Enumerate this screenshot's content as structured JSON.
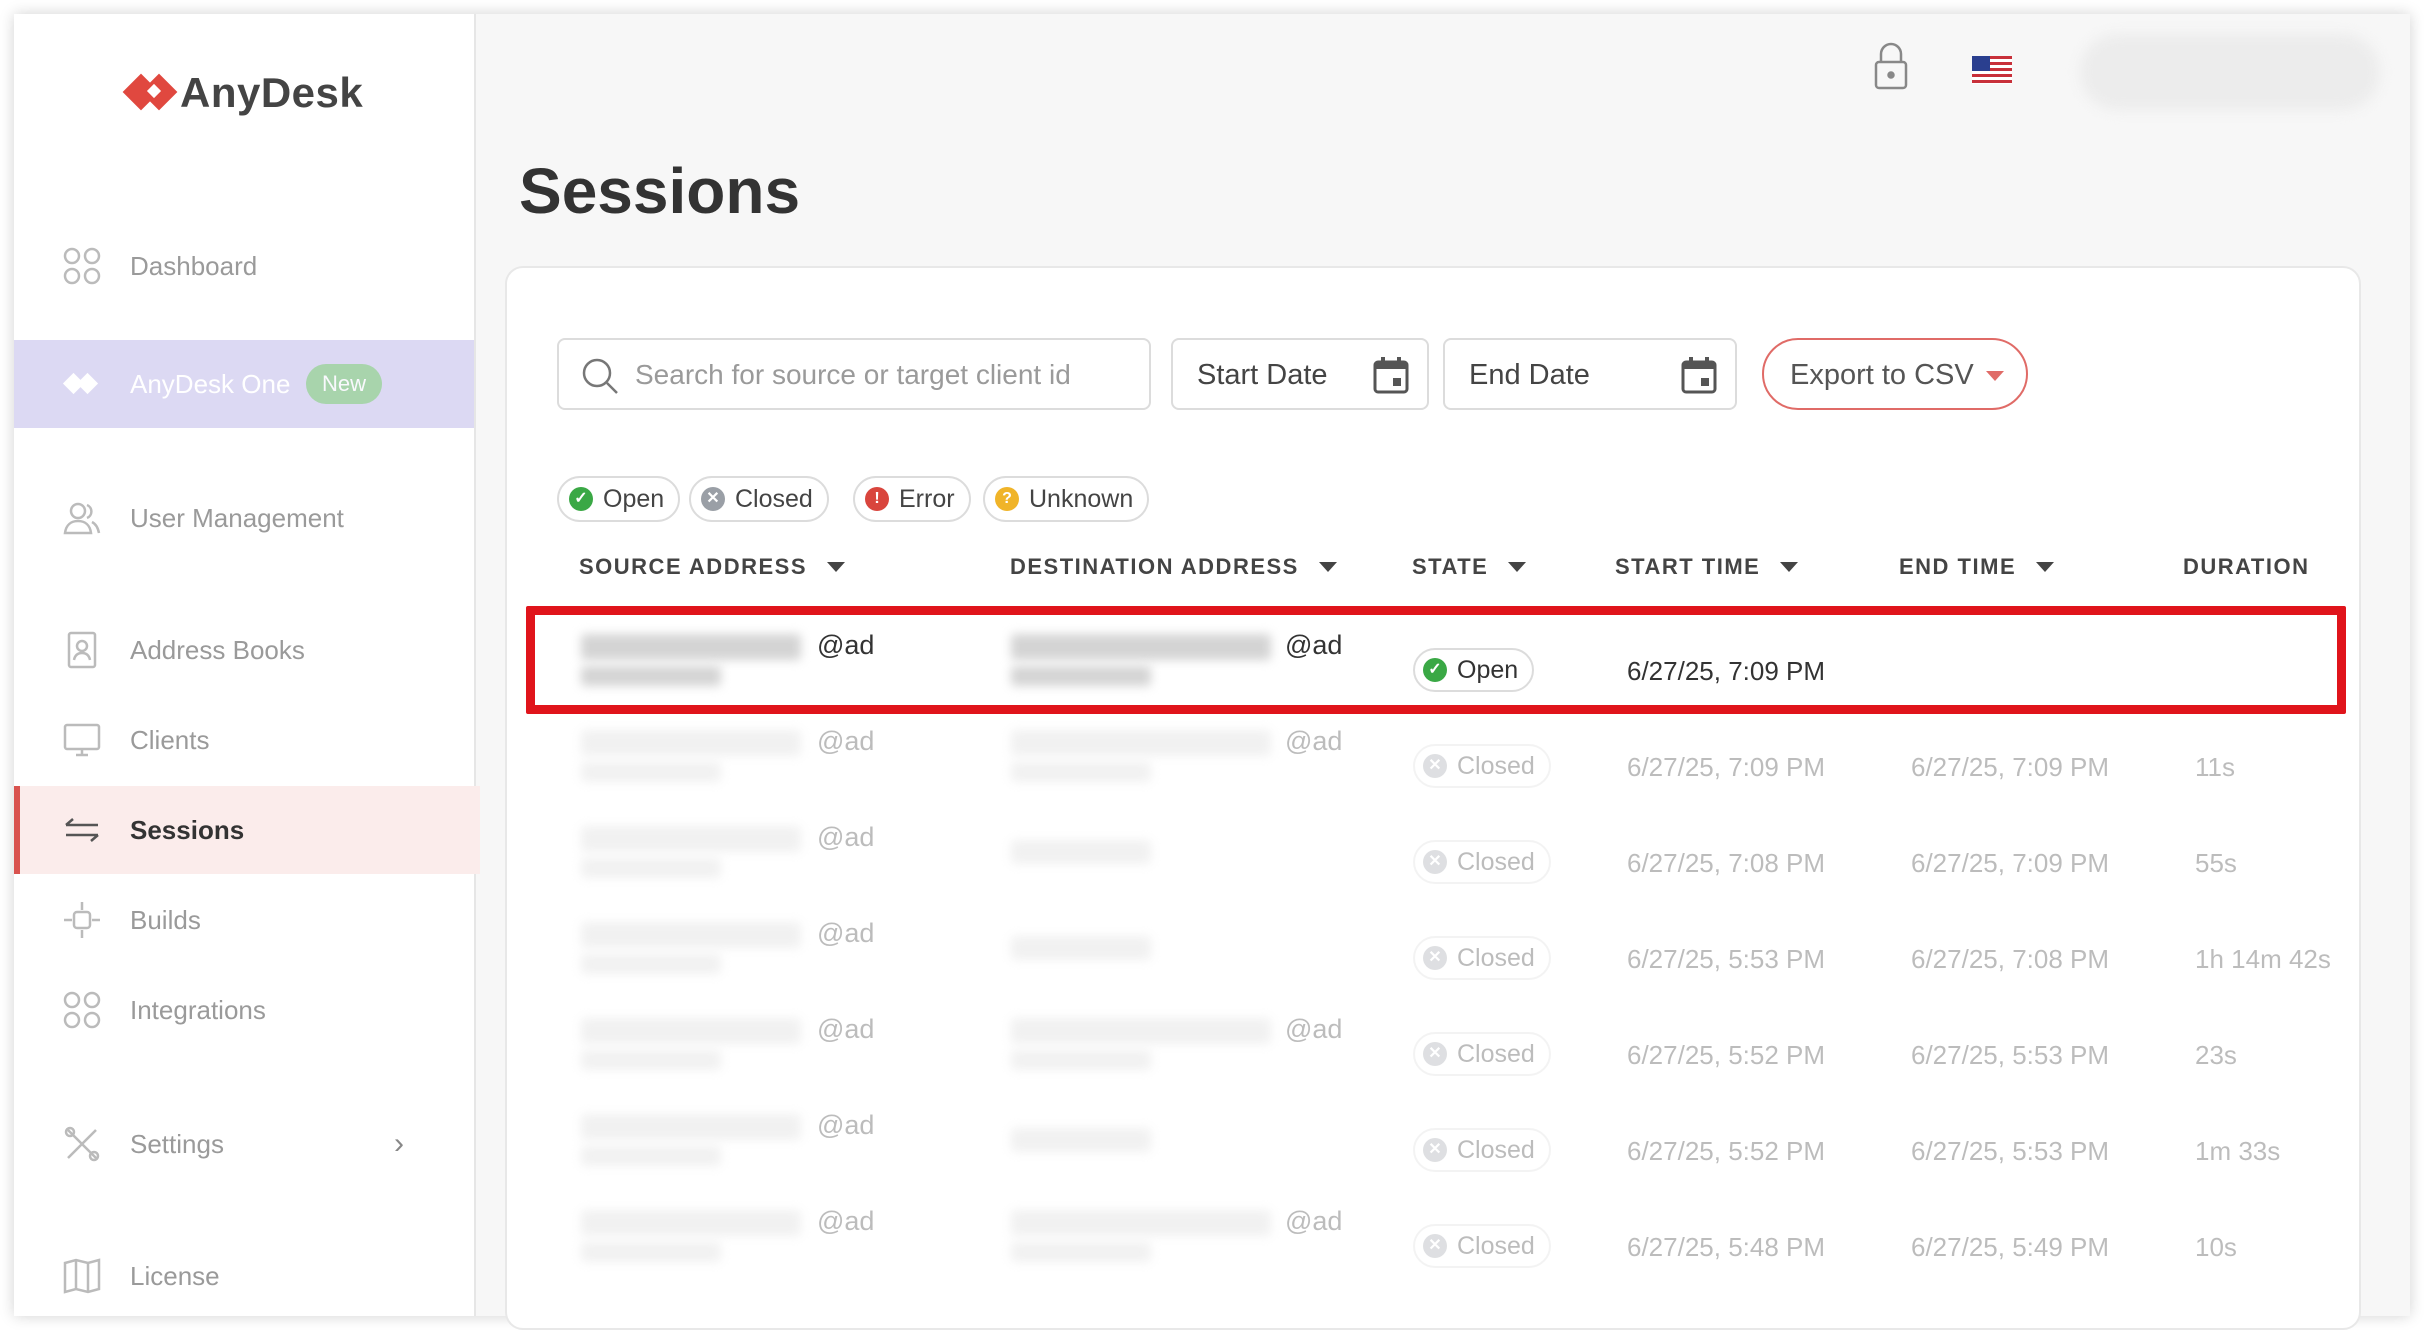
{
  "app": {
    "name": "AnyDesk"
  },
  "sidebar": {
    "items": [
      {
        "label": "Dashboard",
        "icon": "dashboard-icon"
      },
      {
        "label": "AnyDesk One",
        "badge": "New",
        "icon": "anydesk-one-icon"
      },
      {
        "label": "User Management",
        "icon": "users-icon"
      },
      {
        "label": "Address Books",
        "icon": "address-book-icon"
      },
      {
        "label": "Clients",
        "icon": "monitor-icon"
      },
      {
        "label": "Sessions",
        "icon": "sessions-icon",
        "active": true
      },
      {
        "label": "Builds",
        "icon": "builds-icon"
      },
      {
        "label": "Integrations",
        "icon": "integrations-icon"
      },
      {
        "label": "Settings",
        "icon": "settings-icon"
      },
      {
        "label": "License",
        "icon": "license-icon"
      }
    ]
  },
  "header": {
    "lock_icon": "lock-icon",
    "language_flag": "us-flag-icon"
  },
  "page": {
    "title": "Sessions"
  },
  "toolbar": {
    "search_placeholder": "Search for source or target client id",
    "start_date": "Start Date",
    "end_date": "End Date",
    "export": "Export to CSV"
  },
  "filters": [
    {
      "label": "Open",
      "color": "#3aa845"
    },
    {
      "label": "Closed",
      "color": "#9a9fa6"
    },
    {
      "label": "Error",
      "color": "#d9453d"
    },
    {
      "label": "Unknown",
      "color": "#f0b429"
    }
  ],
  "table": {
    "columns": [
      "SOURCE ADDRESS",
      "DESTINATION ADDRESS",
      "STATE",
      "START TIME",
      "END TIME",
      "DURATION"
    ],
    "rows": [
      {
        "source_suffix": "@ad",
        "dest_suffix": "@ad",
        "state": "Open",
        "start": "6/27/25, 7:09 PM",
        "end": "",
        "duration": ""
      },
      {
        "source_suffix": "@ad",
        "dest_suffix": "@ad",
        "state": "Closed",
        "start": "6/27/25, 7:09 PM",
        "end": "6/27/25, 7:09 PM",
        "duration": "11s"
      },
      {
        "source_suffix": "@ad",
        "dest_suffix": "",
        "state": "Closed",
        "start": "6/27/25, 7:08 PM",
        "end": "6/27/25, 7:09 PM",
        "duration": "55s"
      },
      {
        "source_suffix": "@ad",
        "dest_suffix": "",
        "state": "Closed",
        "start": "6/27/25, 5:53 PM",
        "end": "6/27/25, 7:08 PM",
        "duration": "1h 14m 42s"
      },
      {
        "source_suffix": "@ad",
        "dest_suffix": "@ad",
        "state": "Closed",
        "start": "6/27/25, 5:52 PM",
        "end": "6/27/25, 5:53 PM",
        "duration": "23s"
      },
      {
        "source_suffix": "@ad",
        "dest_suffix": "",
        "state": "Closed",
        "start": "6/27/25, 5:52 PM",
        "end": "6/27/25, 5:53 PM",
        "duration": "1m 33s"
      },
      {
        "source_suffix": "@ad",
        "dest_suffix": "@ad",
        "state": "Closed",
        "start": "6/27/25, 5:48 PM",
        "end": "6/27/25, 5:49 PM",
        "duration": "10s"
      }
    ]
  },
  "colors": {
    "accent": "#d9534f",
    "open": "#3aa845",
    "closed": "#9a9fa6",
    "highlight": "#e0141b"
  }
}
